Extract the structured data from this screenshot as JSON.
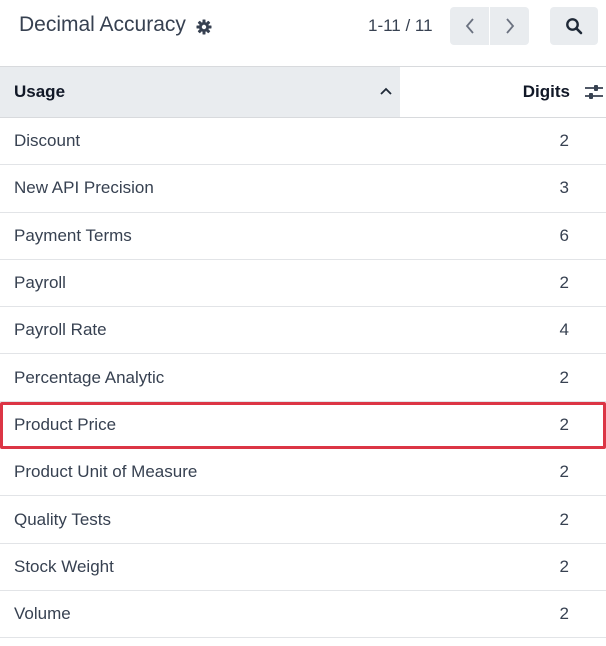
{
  "header": {
    "title": "Decimal Accuracy",
    "pager": "1-11 / 11"
  },
  "table": {
    "columns": [
      "Usage",
      "Digits"
    ],
    "rows": [
      {
        "usage": "Discount",
        "digits": "2"
      },
      {
        "usage": "New API Precision",
        "digits": "3"
      },
      {
        "usage": "Payment Terms",
        "digits": "6"
      },
      {
        "usage": "Payroll",
        "digits": "2"
      },
      {
        "usage": "Payroll Rate",
        "digits": "4"
      },
      {
        "usage": "Percentage Analytic",
        "digits": "2"
      },
      {
        "usage": "Product Price",
        "digits": "2"
      },
      {
        "usage": "Product Unit of Measure",
        "digits": "2"
      },
      {
        "usage": "Quality Tests",
        "digits": "2"
      },
      {
        "usage": "Stock Weight",
        "digits": "2"
      },
      {
        "usage": "Volume",
        "digits": "2"
      }
    ],
    "highlighted_row": "Product Price"
  },
  "icons": {
    "gear": "gear-icon",
    "prev": "chevron-left-icon",
    "next": "chevron-right-icon",
    "search": "search-icon",
    "sort": "chevron-up-icon",
    "optional_columns": "sliders-icon"
  },
  "colors": {
    "highlight": "#dc3545",
    "header_bg": "#e9ecef"
  }
}
